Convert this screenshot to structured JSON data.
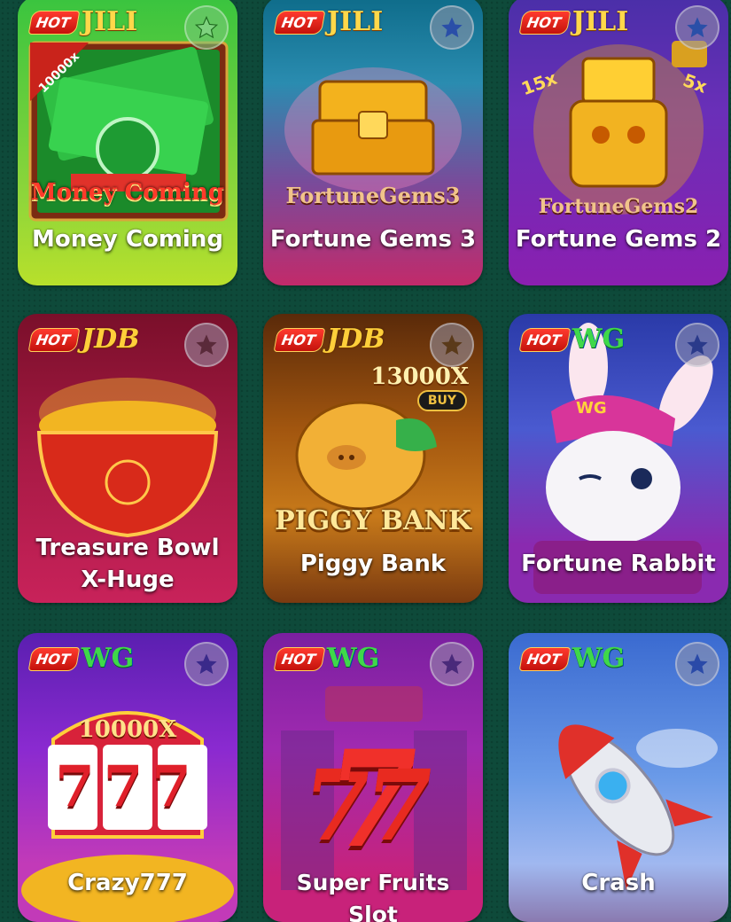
{
  "colors": {
    "page_background": "#0e4a3a",
    "hot_badge": "#e01e14",
    "favorite_button": "#9696aa"
  },
  "games": [
    {
      "title": "Money Coming",
      "badge": "HOT",
      "provider": "JILI",
      "art_text": "Money Coming",
      "art_extra": "10000x",
      "icon": "money-stack-icon"
    },
    {
      "title": "Fortune Gems 3",
      "badge": "HOT",
      "provider": "JILI",
      "art_text": "FortuneGems3",
      "icon": "treasure-chest-icon"
    },
    {
      "title": "Fortune Gems 2",
      "badge": "HOT",
      "provider": "JILI",
      "art_text": "FortuneGems2",
      "art_extra": "15x",
      "art_extra2": "5x",
      "icon": "golden-mask-icon"
    },
    {
      "title": "Treasure Bowl X-Huge",
      "badge": "HOT",
      "provider": "JDB",
      "icon": "treasure-bowl-icon"
    },
    {
      "title": "Piggy Bank",
      "badge": "HOT",
      "provider": "JDB",
      "art_text": "PIGGY BANK",
      "art_extra": "13000X",
      "art_extra2": "BUY",
      "icon": "piggy-icon"
    },
    {
      "title": "Fortune Rabbit",
      "badge": "HOT",
      "provider": "WG",
      "art_extra": "WG",
      "icon": "rabbit-icon"
    },
    {
      "title": "Crazy777",
      "badge": "HOT",
      "provider": "WG",
      "art_text": "777",
      "art_extra": "10000X",
      "icon": "slot-reels-icon"
    },
    {
      "title": "Super Fruits Slot",
      "badge": "HOT",
      "provider": "WG",
      "art_text": "7",
      "icon": "lucky-seven-icon"
    },
    {
      "title": "Crash",
      "badge": "HOT",
      "provider": "WG",
      "icon": "rocket-icon"
    }
  ]
}
